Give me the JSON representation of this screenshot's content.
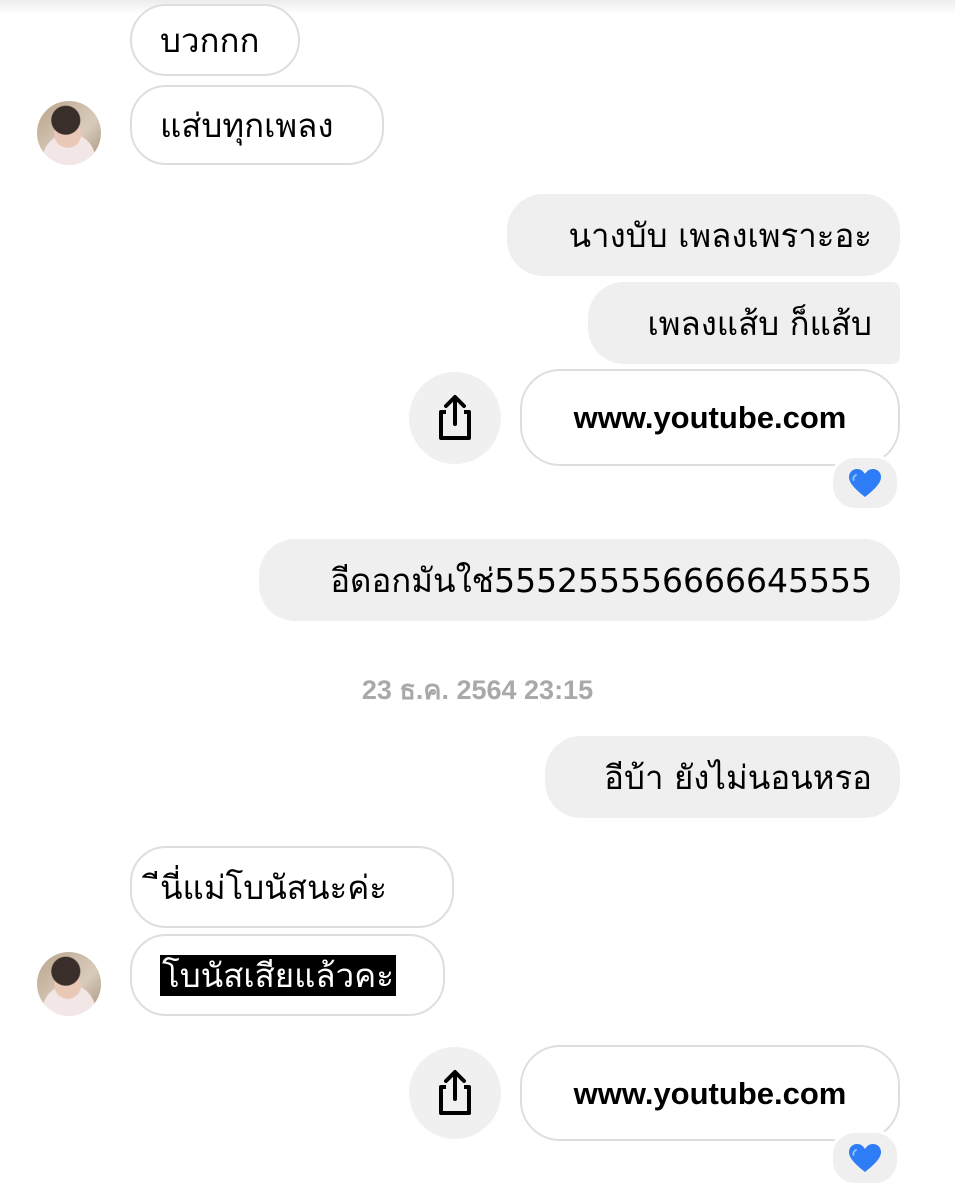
{
  "conversation": {
    "timestamp": "23 ธ.ค. 2564 23:15",
    "messages": [
      {
        "side": "in",
        "text": "บวกกก"
      },
      {
        "side": "in",
        "text": "แส่บทุกเพลง"
      },
      {
        "side": "out",
        "text": "นางบับ เพลงเพราะอะ"
      },
      {
        "side": "out",
        "text": "เพลงแส้บ ก็แส้บ"
      },
      {
        "side": "out",
        "type": "link",
        "text": "www.youtube.com",
        "reaction": "💙"
      },
      {
        "side": "out",
        "text": "อีดอกมันใช่555255556666645555"
      },
      {
        "side": "out",
        "text": "อีบ้า ยังไม่นอนหรอ"
      },
      {
        "side": "in",
        "text": "ีนี่แม่โบนัสนะค่ะ"
      },
      {
        "side": "in",
        "text": "โบนัสเสียแล้วคะ",
        "highlighted": true
      },
      {
        "side": "out",
        "type": "link",
        "text": "www.youtube.com",
        "reaction": "💙"
      }
    ]
  },
  "icons": {
    "share": "share-icon",
    "reaction": "blue-heart-icon"
  },
  "colors": {
    "outgoing_bubble": "#efefef",
    "incoming_border": "#dedede",
    "timestamp": "#a9a9a9",
    "heart": "#2f7df6"
  }
}
